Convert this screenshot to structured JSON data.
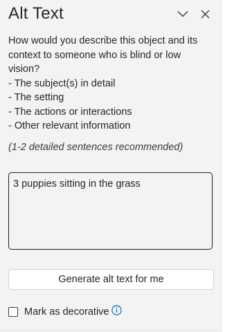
{
  "panel": {
    "title": "Alt Text",
    "collapse_icon": "chevron-down-icon",
    "close_icon": "close-icon"
  },
  "description": {
    "lines": [
      "How would you describe this object and its",
      "context to someone who is blind or low",
      "vision?",
      "- The subject(s) in detail",
      "- The setting",
      "- The actions or interactions",
      "- Other relevant information"
    ],
    "hint": "(1-2 detailed sentences recommended)"
  },
  "alt_text_input": {
    "value": "3 puppies sitting in the grass"
  },
  "generate_button": {
    "label": "Generate alt text for me"
  },
  "decorative": {
    "label": "Mark as decorative",
    "checked": false,
    "info_icon": "info-icon"
  },
  "colors": {
    "panel_bg": "#f3f3f3",
    "text": "#262626",
    "info_blue": "#0f6cbd"
  }
}
